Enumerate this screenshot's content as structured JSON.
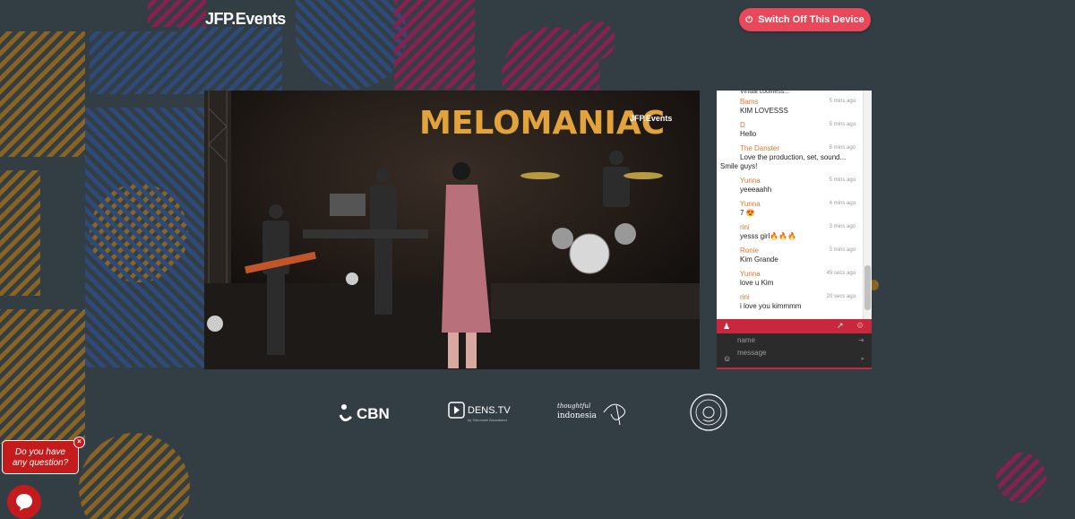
{
  "header": {
    "logo_text": "JFP.Events",
    "switch_button_label": "Switch Off This Device",
    "accent_color": "#e8485a"
  },
  "video": {
    "banner_text": "MELOMANIAC",
    "banner_sub": "JFP.Events"
  },
  "chat": {
    "first_partial": "Virtual coolness...",
    "messages": [
      {
        "name": "Bams",
        "time": "5 mins ago",
        "text": "KIM LOVESSS"
      },
      {
        "name": "D",
        "time": "5 mins ago",
        "text": "Hello"
      },
      {
        "name": "The Danster",
        "time": "5 mins ago",
        "text": "Love the production, set, sound...",
        "text2": "Smile guys!"
      },
      {
        "name": "Yunna",
        "time": "5 mins ago",
        "text": "yeeeaahh"
      },
      {
        "name": "Yunna",
        "time": "4 mins ago",
        "text": "7 😍"
      },
      {
        "name": "rini",
        "time": "3 mins ago",
        "text": "yesss girl🔥🔥🔥"
      },
      {
        "name": "Ronie",
        "time": "3 mins ago",
        "text": "Kim Grande"
      },
      {
        "name": "Yunna",
        "time": "45 secs ago",
        "text": "love u Kim"
      },
      {
        "name": "rini",
        "time": "20 secs ago",
        "text": "i love you kimmmm"
      }
    ],
    "name_placeholder": "name",
    "message_placeholder": "message",
    "bar_color": "#c8283e"
  },
  "sponsors": {
    "cbn": "CBN",
    "dens": "DENS.TV",
    "dens_sub": "by Telkomsel Broadband",
    "ti_top": "thoughtful",
    "ti_bottom": "indonesia"
  },
  "help": {
    "bubble_line1": "Do you have",
    "bubble_line2": "any question?",
    "close_icon": "×"
  }
}
